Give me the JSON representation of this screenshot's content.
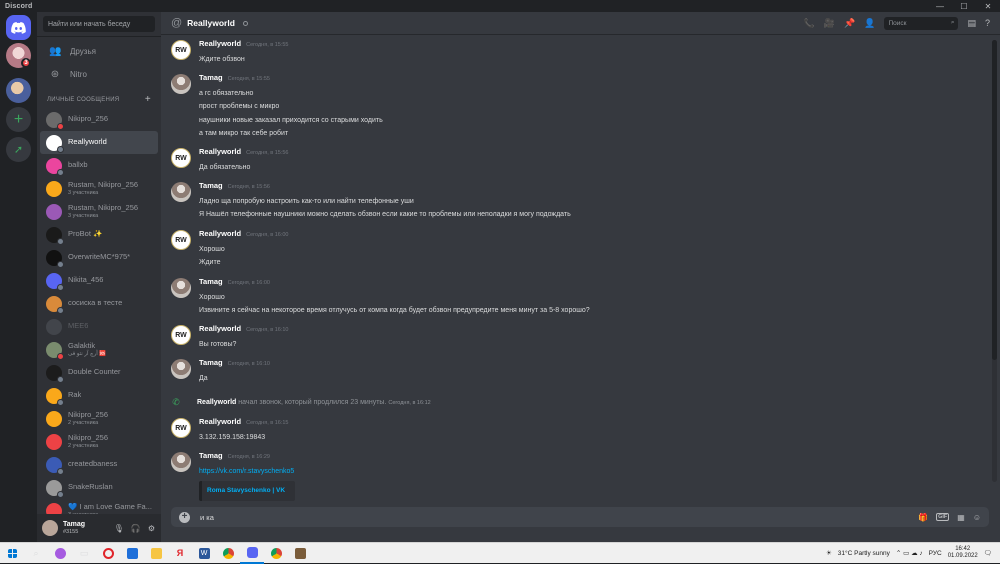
{
  "window": {
    "title": "Discord",
    "controls": [
      "—",
      "☐",
      "✕"
    ]
  },
  "servers": {
    "home_badge": "3"
  },
  "sidebar": {
    "search_placeholder": "Найти или начать беседу",
    "nav": [
      {
        "label": "Друзья"
      },
      {
        "label": "Nitro"
      }
    ],
    "section_title": "ЛИЧНЫЕ СООБЩЕНИЯ",
    "section_add": "+",
    "dms": [
      {
        "name": "Nikipro_256",
        "sub": "",
        "color": "#6b6b6b",
        "status": "#ed4245"
      },
      {
        "name": "Reallyworld",
        "sub": "",
        "color": "#ffffff",
        "status": "#747f8d",
        "active": true
      },
      {
        "name": "ballxb",
        "sub": "",
        "color": "#eb459e",
        "status": "#747f8d"
      },
      {
        "name": "Rustam, Nikipro_256",
        "sub": "3 участника",
        "color": "#faa81a",
        "status": ""
      },
      {
        "name": "Rustam, Nikipro_256",
        "sub": "3 участника",
        "color": "#9b59b6",
        "status": ""
      },
      {
        "name": "ProBot ✨",
        "sub": "",
        "color": "#1a1a1a",
        "status": "#747f8d"
      },
      {
        "name": "OverwriteMC*975*",
        "sub": "",
        "color": "#111111",
        "status": "#747f8d"
      },
      {
        "name": "Nikita_456",
        "sub": "",
        "color": "#5865f2",
        "status": "#747f8d"
      },
      {
        "name": "сосиска в тесте",
        "sub": "",
        "color": "#d98a3a",
        "status": "#747f8d"
      },
      {
        "name": "MEE6",
        "sub": "",
        "color": "#5a5f66",
        "status": "",
        "dim": true
      },
      {
        "name": "Galaktik",
        "sub": "آرچ آر نتو فی 🆘",
        "color": "#7a8c6e",
        "status": "#ed4245"
      },
      {
        "name": "Double Counter",
        "sub": "",
        "color": "#1c1c1c",
        "status": "#747f8d"
      },
      {
        "name": "Rak",
        "sub": "",
        "color": "#faa81a",
        "status": "#747f8d"
      },
      {
        "name": "Nikipro_256",
        "sub": "2 участника",
        "color": "#faa81a",
        "status": ""
      },
      {
        "name": "Nikipro_256",
        "sub": "2 участника",
        "color": "#ed4245",
        "status": ""
      },
      {
        "name": "createdbaness",
        "sub": "",
        "color": "#3b5bb5",
        "status": "#747f8d"
      },
      {
        "name": "SnakeRuslan",
        "sub": "",
        "color": "#9a9a9a",
        "status": "#747f8d"
      },
      {
        "name": "💙 I am Love Game Fa...",
        "sub": "3 участника",
        "color": "#ed4245",
        "status": ""
      }
    ],
    "user": {
      "name": "Tamag",
      "tag": "#3155"
    }
  },
  "channel": {
    "name": "Reallyworld",
    "search_placeholder": "Поиск"
  },
  "messages": [
    {
      "author": "Reallyworld",
      "av": "rw",
      "time": "Сегодня, в 15:55",
      "lines": [
        "Ждите обзвон"
      ]
    },
    {
      "author": "Tamag",
      "av": "tm",
      "time": "Сегодня, в 15:55",
      "lines": [
        "а гс обязательно",
        "прост проблемы с микро",
        "наушники  новые заказал приходится со старыми ходить",
        "а там микро так себе робит"
      ]
    },
    {
      "author": "Reallyworld",
      "av": "rw",
      "time": "Сегодня, в 15:56",
      "lines": [
        "Да обязательно"
      ]
    },
    {
      "author": "Tamag",
      "av": "tm",
      "time": "Сегодня, в 15:56",
      "lines": [
        "Ладно ща попробую настроить как-то или найти телефонные уши",
        "Я Нашёл телефонные наушники можно сделать обзвон если какие то проблемы или неполадки я могу подождать"
      ]
    },
    {
      "author": "Reallyworld",
      "av": "rw",
      "time": "Сегодня, в 16:00",
      "lines": [
        "Хорошо",
        "Ждите"
      ]
    },
    {
      "author": "Tamag",
      "av": "tm",
      "time": "Сегодня, в 16:00",
      "lines": [
        "Хорошо",
        "Извините я сейчас на некоторое время отлучусь от компа когда будет обзвон предупредите меня минут за 5-8 хорошо?"
      ]
    },
    {
      "author": "Reallyworld",
      "av": "rw",
      "time": "Сегодня, в 16:10",
      "lines": [
        "Вы готовы?"
      ]
    },
    {
      "author": "Tamag",
      "av": "tm",
      "time": "Сегодня, в 16:10",
      "lines": [
        "Да"
      ]
    },
    {
      "author": "Reallyworld",
      "av": "rw",
      "time": "Сегодня, в 16:15",
      "lines": [
        "3.132.159.158:19843"
      ]
    },
    {
      "author": "Tamag",
      "av": "tm",
      "time": "Сегодня, в 16:29",
      "lines": [],
      "link": "https://vk.com/r.stavyschenko5",
      "embed": "Roma Stavyschenko | VK"
    }
  ],
  "call": {
    "author": "Reallyworld",
    "text": "начал звонок, который продлился 23 минуты.",
    "time": "Сегодня, в 16:12"
  },
  "composer": {
    "value": "и ка",
    "gif": "GIF"
  },
  "taskbar": {
    "weather": "31°C  Partly sunny",
    "lang": "РУС",
    "time": "16:42",
    "date": "01.09.2022"
  }
}
